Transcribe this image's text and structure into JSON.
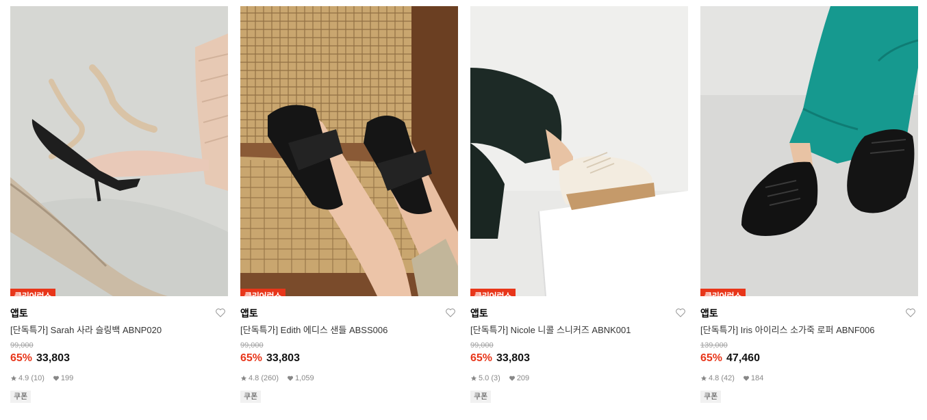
{
  "products": [
    {
      "badge": "클리어런스",
      "brand": "앱토",
      "title": "[단독특가] Sarah 사라 슬링백 ABNP020",
      "original_price": "99,000",
      "discount": "65%",
      "price": "33,803",
      "rating": "4.9",
      "review_count": "(10)",
      "likes": "199",
      "coupon": "쿠폰"
    },
    {
      "badge": "클리어런스",
      "brand": "앱토",
      "title": "[단독특가] Edith 에디스 샌들 ABSS006",
      "original_price": "99,000",
      "discount": "65%",
      "price": "33,803",
      "rating": "4.8",
      "review_count": "(260)",
      "likes": "1,059",
      "coupon": "쿠폰"
    },
    {
      "badge": "클리어런스",
      "brand": "앱토",
      "title": "[단독특가] Nicole 니콜 스니커즈 ABNK001",
      "original_price": "99,000",
      "discount": "65%",
      "price": "33,803",
      "rating": "5.0",
      "review_count": "(3)",
      "likes": "209",
      "coupon": "쿠폰"
    },
    {
      "badge": "클리어런스",
      "brand": "앱토",
      "title": "[단독특가] Iris 아이리스 소가죽 로퍼 ABNF006",
      "original_price": "139,000",
      "discount": "65%",
      "price": "47,460",
      "rating": "4.8",
      "review_count": "(42)",
      "likes": "184",
      "coupon": "쿠폰"
    }
  ],
  "colors": {
    "accent": "#e8361a",
    "text": "#111111",
    "muted": "#888888"
  },
  "icons": [
    "heart-outline-icon",
    "star-icon",
    "heart-icon"
  ]
}
